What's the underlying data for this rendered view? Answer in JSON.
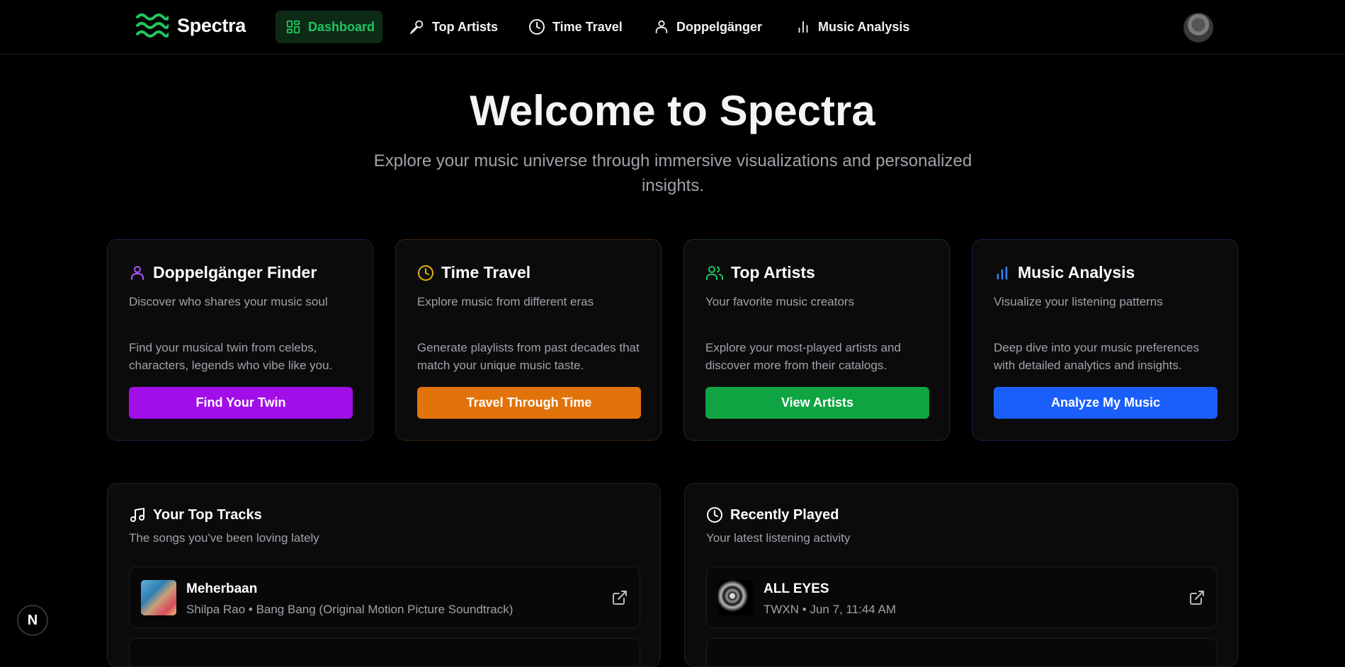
{
  "brand": {
    "name": "Spectra",
    "accent": "#22c55e"
  },
  "nav": {
    "items": [
      {
        "label": "Dashboard",
        "icon": "dashboard-grid-icon",
        "active": true
      },
      {
        "label": "Top Artists",
        "icon": "microphone-icon",
        "active": false
      },
      {
        "label": "Time Travel",
        "icon": "clock-icon",
        "active": false
      },
      {
        "label": "Doppelgänger",
        "icon": "user-icon",
        "active": false
      },
      {
        "label": "Music Analysis",
        "icon": "bar-chart-icon",
        "active": false
      }
    ]
  },
  "hero": {
    "title": "Welcome to Spectra",
    "subtitle": "Explore your music universe through immersive visualizations and personalized insights."
  },
  "cards": [
    {
      "title": "Doppelgänger Finder",
      "subtitle": "Discover who shares your music soul",
      "body": "Find your musical twin from celebs, characters, legends who vibe like you.",
      "button": "Find Your Twin",
      "color": "#a10ee8",
      "icon": "user-icon"
    },
    {
      "title": "Time Travel",
      "subtitle": "Explore music from different eras",
      "body": "Generate playlists from past decades that match your unique music taste.",
      "button": "Travel Through Time",
      "color": "#e2720a",
      "icon": "clock-icon"
    },
    {
      "title": "Top Artists",
      "subtitle": "Your favorite music creators",
      "body": "Explore your most-played artists and discover more from their catalogs.",
      "button": "View Artists",
      "color": "#0ea441",
      "icon": "users-icon"
    },
    {
      "title": "Music Analysis",
      "subtitle": "Visualize your listening patterns",
      "body": "Deep dive into your music preferences with detailed analytics and insights.",
      "button": "Analyze My Music",
      "color": "#1a5ffa",
      "icon": "bar-chart-icon"
    }
  ],
  "top_tracks": {
    "title": "Your Top Tracks",
    "subtitle": "The songs you've been loving lately",
    "items": [
      {
        "title": "Meherbaan",
        "meta": "Shilpa Rao • Bang Bang (Original Motion Picture Soundtrack)"
      }
    ]
  },
  "recently_played": {
    "title": "Recently Played",
    "subtitle": "Your latest listening activity",
    "items": [
      {
        "title": "ALL EYES",
        "meta": "TWXN • Jun 7, 11:44 AM"
      }
    ]
  },
  "dev_badge": "N"
}
